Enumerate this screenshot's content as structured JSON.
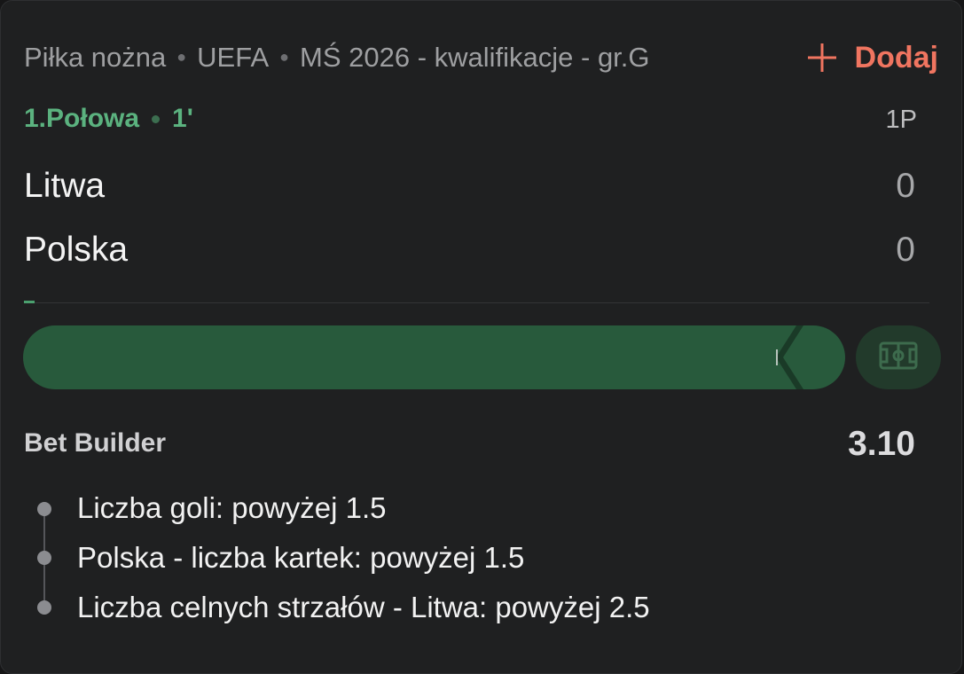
{
  "header": {
    "breadcrumb": [
      "Piłka nożna",
      "UEFA",
      "MŚ 2026 - kwalifikacje - gr.G"
    ],
    "add_label": "Dodaj",
    "add_icon": "plus-icon",
    "accent_color": "#f07560"
  },
  "match": {
    "period": "1.Połowa",
    "minute": "1'",
    "period_column": "1P",
    "home_team": "Litwa",
    "away_team": "Polska",
    "home_score": "0",
    "away_score": "0",
    "live_color": "#5bb27f",
    "progress_fraction": 0.012
  },
  "field": {
    "icon": "pitch-icon"
  },
  "bet_builder": {
    "title": "Bet Builder",
    "odds": "3.10",
    "selections": [
      "Liczba goli: powyżej 1.5",
      "Polska - liczba kartek: powyżej 1.5",
      "Liczba celnych strzałów - Litwa: powyżej 2.5"
    ]
  }
}
